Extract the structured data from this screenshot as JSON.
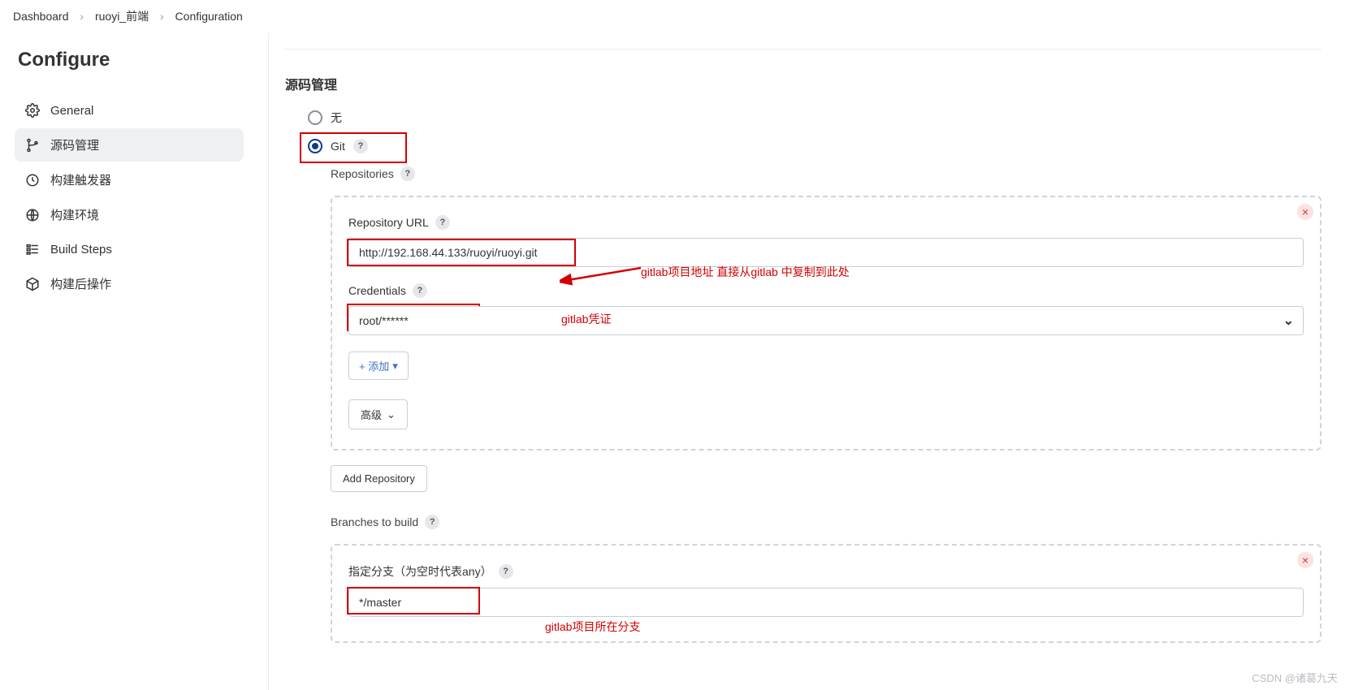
{
  "breadcrumb": {
    "items": [
      "Dashboard",
      "ruoyi_前端",
      "Configuration"
    ]
  },
  "sidebar": {
    "title": "Configure",
    "items": [
      {
        "label": "General",
        "icon": "gear"
      },
      {
        "label": "源码管理",
        "icon": "branch"
      },
      {
        "label": "构建触发器",
        "icon": "clock"
      },
      {
        "label": "构建环境",
        "icon": "globe"
      },
      {
        "label": "Build Steps",
        "icon": "steps"
      },
      {
        "label": "构建后操作",
        "icon": "package"
      }
    ]
  },
  "section": {
    "title": "源码管理",
    "radio_none": "无",
    "radio_git": "Git"
  },
  "repos": {
    "label": "Repositories",
    "repo_url_label": "Repository URL",
    "repo_url_value": "http://192.168.44.133/ruoyi/ruoyi.git",
    "credentials_label": "Credentials",
    "credentials_value": "root/******",
    "add_btn": "+ 添加",
    "advanced_btn": "高级",
    "add_repo_btn": "Add Repository"
  },
  "branches": {
    "label": "Branches to build",
    "spec_label": "指定分支（为空时代表any）",
    "spec_value": "*/master"
  },
  "annotations": {
    "url": "gitlab项目地址   直接从gitlab 中复制到此处",
    "cred": "gitlab凭证",
    "branch": "gitlab项目所在分支"
  },
  "watermark": "CSDN @诸葛九天"
}
